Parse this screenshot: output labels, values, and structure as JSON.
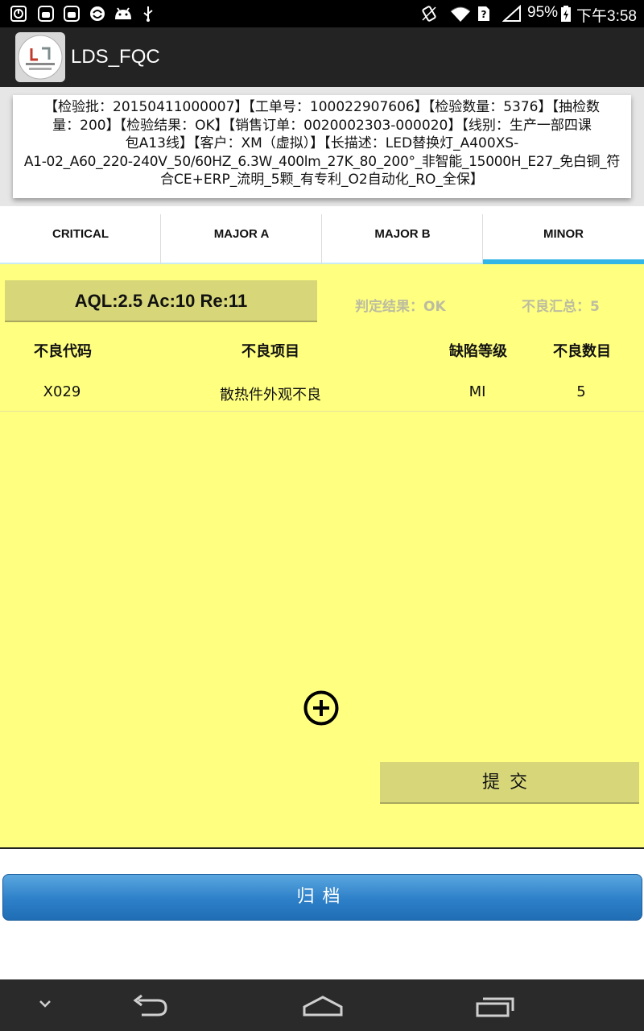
{
  "status_bar": {
    "battery": "95%",
    "time": "下午3:58",
    "icons": [
      "alarm-icon",
      "android-notify-icon",
      "android-notify-icon",
      "sync-icon",
      "android-robot-icon",
      "usb-icon",
      "vibrate-icon",
      "wifi-icon",
      "no-sim-icon",
      "signal-icon",
      "battery-charging-icon"
    ]
  },
  "app": {
    "title": "LDS_FQC",
    "logo_icon": "leedarson-logo"
  },
  "info": {
    "lines": [
      "【检验批：20150411000007】【工单号：100022907606】【检验数量：5376】【抽检数",
      "量：200】【检验结果：OK】【销售订单：0020002303-000020】【线别：生产一部四课",
      "包A13线】【客户：XM（虚拟）】【长描述：LED替换灯_A400XS-",
      "A1-02_A60_220-240V_50/60HZ_6.3W_400lm_27K_80_200°_非智能_15000H_E27_免白铜_符",
      "合CE+ERP_流明_5颗_有专利_O2自动化_RO_全保】"
    ]
  },
  "tabs": [
    {
      "label": "CRITICAL"
    },
    {
      "label": "MAJOR A"
    },
    {
      "label": "MAJOR B"
    },
    {
      "label": "MINOR"
    }
  ],
  "active_tab": "MINOR",
  "panel": {
    "aql_label": "AQL:2.5 Ac:10 Re:11",
    "judge_result": "判定结果：OK",
    "defect_total": "不良汇总：5",
    "columns": [
      "不良代码",
      "不良项目",
      "缺陷等级",
      "不良数目"
    ],
    "rows": [
      {
        "code": "X029",
        "item": "散热件外观不良",
        "level": "MI",
        "count": "5"
      }
    ],
    "add_icon": "add-circle-icon",
    "submit_label": "提交"
  },
  "archive_label": "归档",
  "nav_bar": {
    "icons": [
      "hide-keyboard-icon",
      "back-icon",
      "home-icon",
      "recent-apps-icon"
    ]
  },
  "colors": {
    "panel_bg": "#ffff80",
    "tab_indicator": "#33b5e5",
    "archive_button": "#2d80c8"
  }
}
